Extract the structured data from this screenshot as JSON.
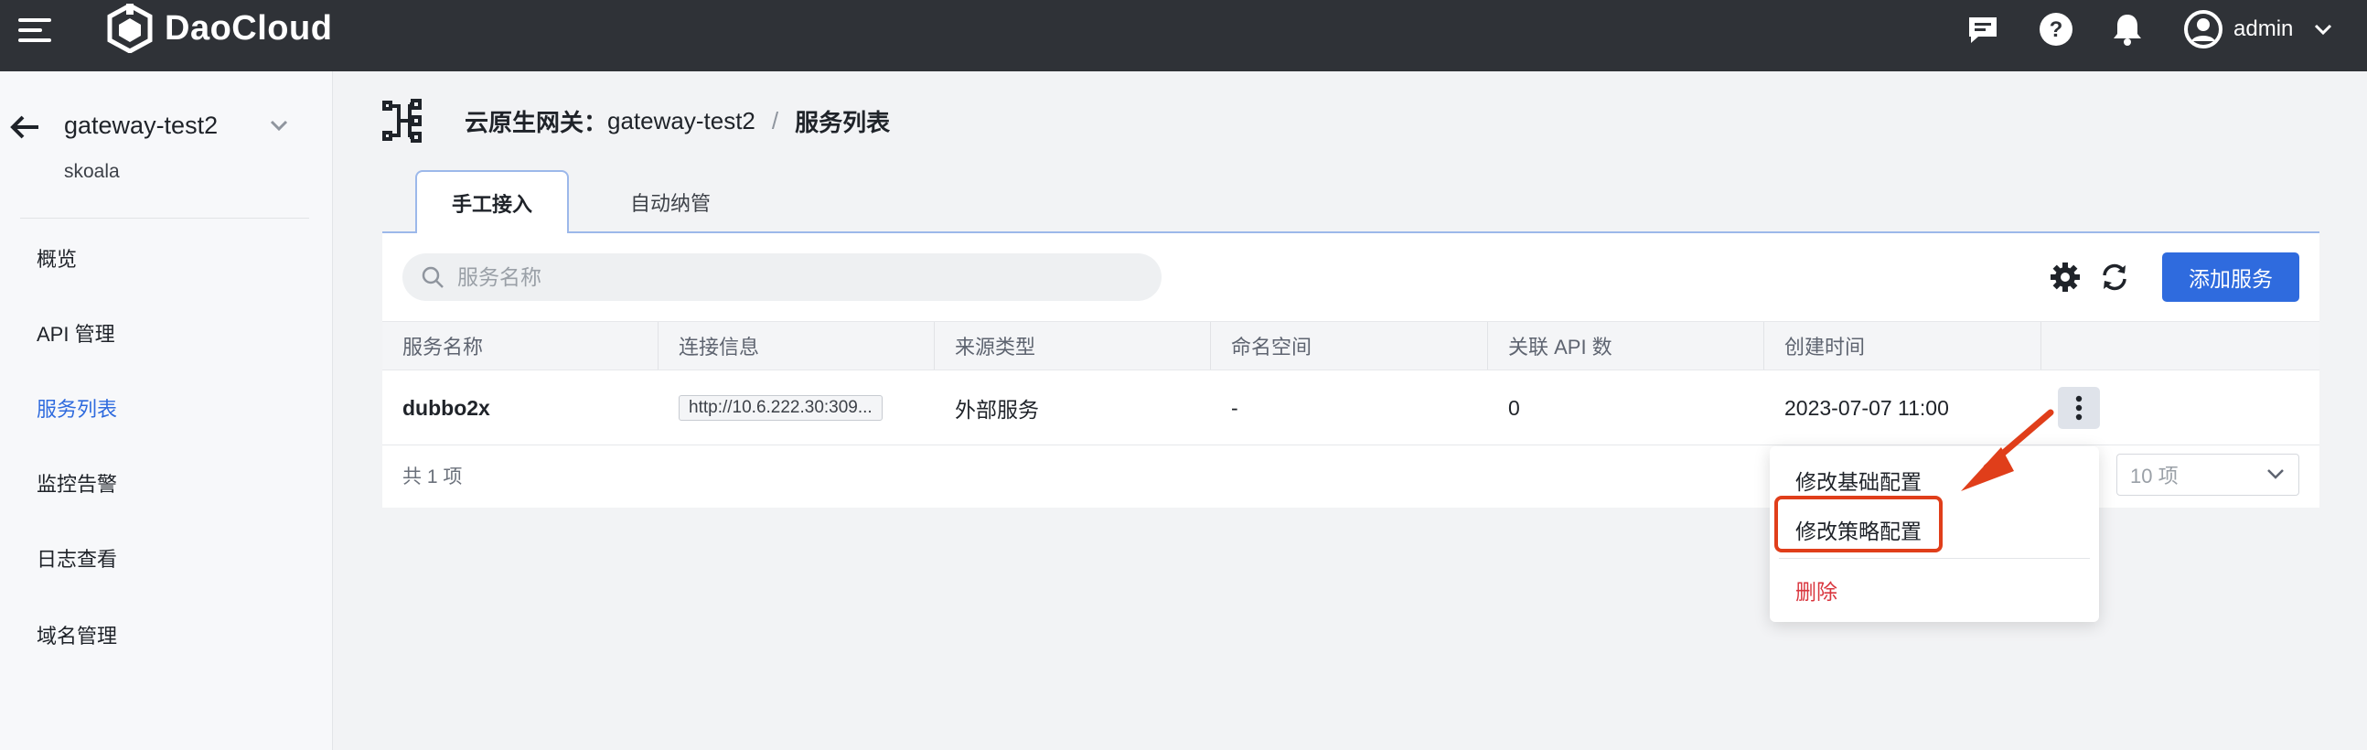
{
  "topbar": {
    "brand": "DaoCloud",
    "user": "admin",
    "icons": [
      "menu-icon",
      "logo-icon",
      "message-icon",
      "help-icon",
      "bell-icon",
      "user-avatar-icon",
      "chevron-down-icon"
    ]
  },
  "sidebar": {
    "gateway_name": "gateway-test2",
    "gateway_sub": "skoala",
    "items": [
      {
        "label": "概览",
        "active": false
      },
      {
        "label": "API 管理",
        "active": false
      },
      {
        "label": "服务列表",
        "active": true
      },
      {
        "label": "监控告警",
        "active": false
      },
      {
        "label": "日志查看",
        "active": false
      },
      {
        "label": "域名管理",
        "active": false
      }
    ]
  },
  "breadcrumb": {
    "prefix": "云原生网关：",
    "gateway": "gateway-test2",
    "separator": "/",
    "current": "服务列表"
  },
  "tabs": [
    {
      "label": "手工接入",
      "active": true
    },
    {
      "label": "自动纳管",
      "active": false
    }
  ],
  "toolbar": {
    "search_placeholder": "服务名称",
    "add_label": "添加服务"
  },
  "table": {
    "columns": [
      "服务名称",
      "连接信息",
      "来源类型",
      "命名空间",
      "关联 API 数",
      "创建时间"
    ],
    "rows": [
      {
        "name": "dubbo2x",
        "connection": "http://10.6.222.30:309...",
        "source": "外部服务",
        "namespace": "-",
        "api_count": "0",
        "created": "2023-07-07 11:00"
      }
    ],
    "total": "共 1 项",
    "page_size": "10 项"
  },
  "menu": {
    "items": [
      {
        "label": "修改基础配置"
      },
      {
        "label": "修改策略配置",
        "highlighted": true
      },
      {
        "label": "删除",
        "danger": true
      }
    ]
  },
  "colors": {
    "topbar": "#2f3237",
    "primary": "#2f6bde",
    "danger": "#d9363e",
    "annotation": "#e03e1a"
  }
}
